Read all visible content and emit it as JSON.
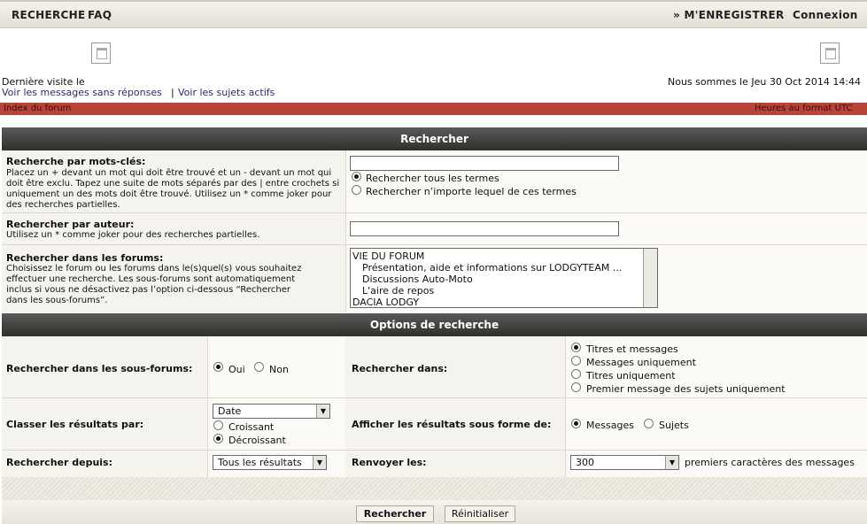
{
  "nav": {
    "search": "RECHERCHE",
    "faq": "FAQ",
    "register": "» M'ENREGISTRER",
    "login": "Connexion"
  },
  "info": {
    "last_visit": "Dernière visite le",
    "unanswered": "Voir les messages sans réponses",
    "separator": "|",
    "active": "Voir les sujets actifs",
    "now": "Nous sommes le Jeu 30 Oct 2014 14:44"
  },
  "breadcrumb": {
    "index": "Index du forum",
    "timezone": "Heures au format UTC"
  },
  "search": {
    "title": "Rechercher",
    "keywords_label": "Recherche par mots-clés:",
    "keywords_desc": "Placez un + devant un mot qui doit être trouvé et un - devant un mot qui doit être exclu. Tapez une suite de mots séparés par des | entre crochets si uniquement un des mots doit être trouvé. Utilisez un * comme joker pour des recherches partielles.",
    "keywords_value": "",
    "all_terms": "Rechercher tous les termes",
    "any_terms": "Rechercher n’importe lequel de ces termes",
    "author_label": "Rechercher par auteur:",
    "author_desc": "Utilisez un * comme joker pour des recherches partielles.",
    "author_value": "",
    "forums_label": "Rechercher dans les forums:",
    "forums_desc": "Choisissez le forum ou les forums dans le(s)quel(s) vous souhaitez effectuer une recherche. Les sous-forums sont automatiquement inclus si vous ne désactivez pas l’option ci-dessous “Rechercher dans les sous-forums”.",
    "forums": [
      "VIE DU FORUM",
      "Présentation, aide et informations sur LODGYTEAM ...",
      "Discussions Auto-Moto",
      "L'aire de repos",
      "DACIA LODGY"
    ]
  },
  "options": {
    "title": "Options de recherche",
    "subforums_label": "Rechercher dans les sous-forums:",
    "yes": "Oui",
    "no": "Non",
    "search_in_label": "Rechercher dans:",
    "search_in": [
      "Titres et messages",
      "Messages uniquement",
      "Titres uniquement",
      "Premier message des sujets uniquement"
    ],
    "sort_label": "Classer les résultats par:",
    "sort_value": "Date",
    "asc": "Croissant",
    "desc": "Décroissant",
    "display_label": "Afficher les résultats sous forme de:",
    "messages": "Messages",
    "topics": "Sujets",
    "since_label": "Rechercher depuis:",
    "since_value": "Tous les résultats",
    "return_label": "Renvoyer les:",
    "return_value": "300",
    "return_suffix": "premiers caractères des messages"
  },
  "buttons": {
    "submit": "Rechercher",
    "reset": "Réinitialiser"
  }
}
